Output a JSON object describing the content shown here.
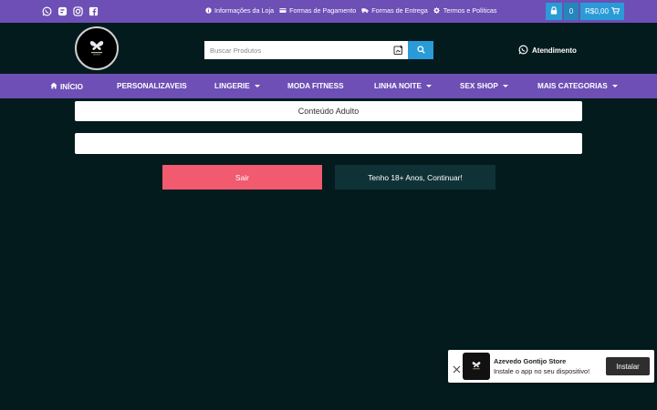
{
  "topbar": {
    "social_icons": [
      "whatsapp-icon",
      "blog-icon",
      "instagram-icon",
      "facebook-icon"
    ],
    "links": [
      {
        "icon": "info-icon",
        "label": "Informações da Loja"
      },
      {
        "icon": "credit-card-icon",
        "label": "Formas de Pagamento"
      },
      {
        "icon": "truck-icon",
        "label": "Formas de Entrega"
      },
      {
        "icon": "gear-icon",
        "label": "Termos e Políticas"
      }
    ],
    "cart": {
      "count": "0",
      "total": "R$0,00"
    }
  },
  "header": {
    "search_placeholder": "Buscar Produtos",
    "support_label": "Atendimento"
  },
  "nav": {
    "items": [
      {
        "label": "INÍCIO",
        "dropdown": false
      },
      {
        "label": "PERSONALIZAVEIS",
        "dropdown": false
      },
      {
        "label": "LINGERIE",
        "dropdown": true
      },
      {
        "label": "MODA FITNESS",
        "dropdown": false
      },
      {
        "label": "LINHA NOITE",
        "dropdown": true
      },
      {
        "label": "SEX SHOP",
        "dropdown": true
      },
      {
        "label": "MAIS CATEGORIAS",
        "dropdown": true
      }
    ]
  },
  "age_gate": {
    "title": "Conteúdo Adulto",
    "exit_label": "Sair",
    "continue_label": "Tenho 18+ Anos, Continuar!"
  },
  "install_prompt": {
    "store_name": "Azevedo Gontijo Store",
    "description": "Instale o app no seu dispositivo!",
    "install_label": "Instalar"
  },
  "colors": {
    "bar_purple": "#6d4fb5",
    "background": "#041b1e",
    "accent_blue": "#2a9bd6",
    "exit_red": "#f15a6f",
    "continue_dark": "#0f3237"
  }
}
